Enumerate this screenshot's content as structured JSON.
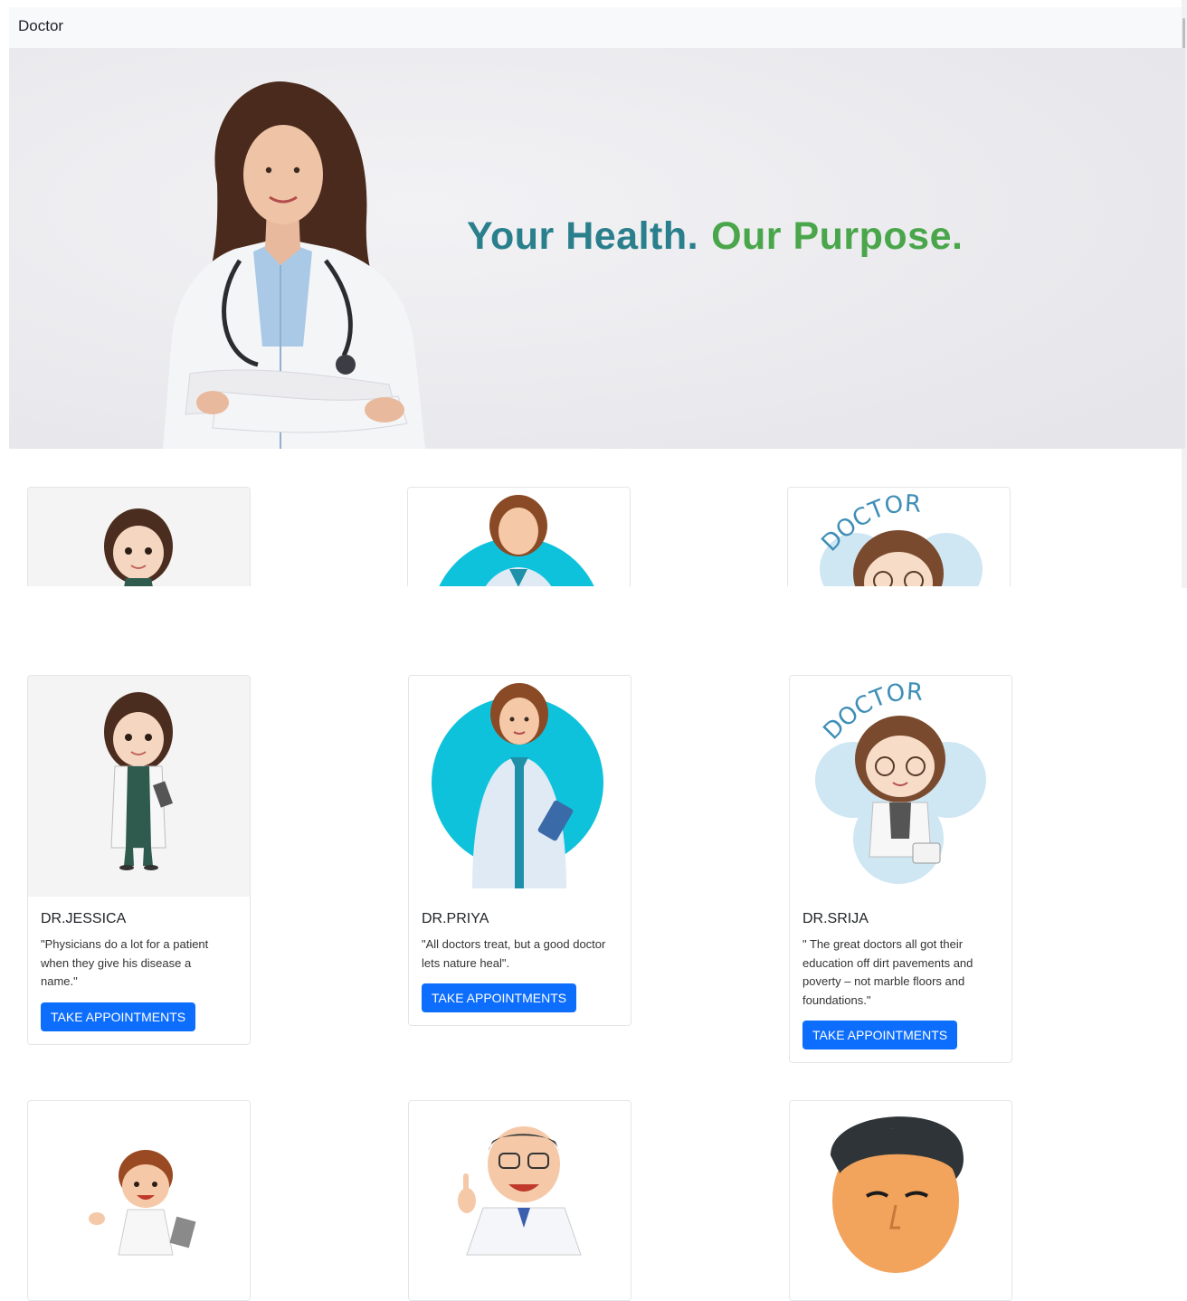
{
  "navbar": {
    "brand": "Doctor"
  },
  "hero": {
    "tagline_part1": "Your Health.",
    "tagline_part2": "Our Purpose."
  },
  "doctors": [
    {
      "name": "DR.JESSICA",
      "quote": "\"Physicians do a lot for a patient when they give his disease a name.\"",
      "button": "TAKE APPOINTMENTS"
    },
    {
      "name": "DR.PRIYA",
      "quote": "\"All doctors treat, but a good doctor lets nature heal\".",
      "button": "TAKE APPOINTMENTS"
    },
    {
      "name": "DR.SRIJA",
      "quote": "\" The great doctors all got their education off dirt pavements and poverty – not marble floors and foundations.\"",
      "button": "TAKE APPOINTMENTS"
    }
  ],
  "illustration_text": {
    "doctor_arc": "DOCTOR"
  },
  "colors": {
    "button": "#0d6efd",
    "tagline_teal": "#2a7f8c",
    "tagline_green": "#4aa64a",
    "navbar_bg": "#f8f9fa"
  }
}
